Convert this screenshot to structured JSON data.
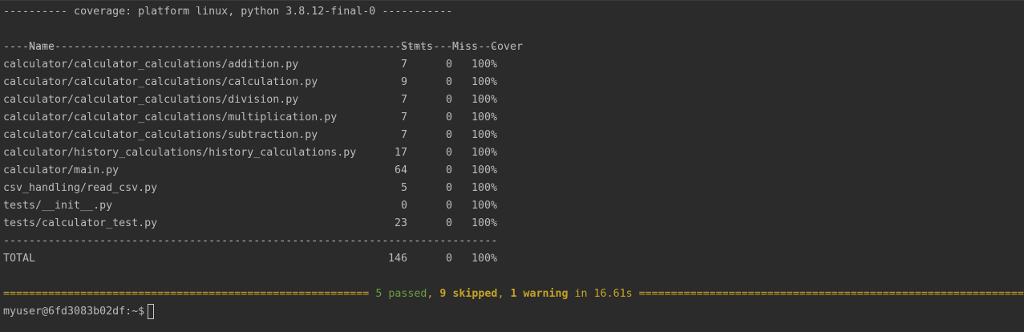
{
  "header_line": "---------- coverage: platform linux, python 3.8.12-final-0 -----------",
  "columns": {
    "name": "Name",
    "stmts": "Stmts",
    "miss": "Miss",
    "cover": "Cover"
  },
  "separator": "-----------------------------------------------------------------------------",
  "rows": [
    {
      "name": "calculator/calculator_calculations/addition.py",
      "stmts": "7",
      "miss": "0",
      "cover": "100%"
    },
    {
      "name": "calculator/calculator_calculations/calculation.py",
      "stmts": "9",
      "miss": "0",
      "cover": "100%"
    },
    {
      "name": "calculator/calculator_calculations/division.py",
      "stmts": "7",
      "miss": "0",
      "cover": "100%"
    },
    {
      "name": "calculator/calculator_calculations/multiplication.py",
      "stmts": "7",
      "miss": "0",
      "cover": "100%"
    },
    {
      "name": "calculator/calculator_calculations/subtraction.py",
      "stmts": "7",
      "miss": "0",
      "cover": "100%"
    },
    {
      "name": "calculator/history_calculations/history_calculations.py",
      "stmts": "17",
      "miss": "0",
      "cover": "100%"
    },
    {
      "name": "calculator/main.py",
      "stmts": "64",
      "miss": "0",
      "cover": "100%"
    },
    {
      "name": "csv_handling/read_csv.py",
      "stmts": "5",
      "miss": "0",
      "cover": "100%"
    },
    {
      "name": "tests/__init__.py",
      "stmts": "0",
      "miss": "0",
      "cover": "100%"
    },
    {
      "name": "tests/calculator_test.py",
      "stmts": "23",
      "miss": "0",
      "cover": "100%"
    }
  ],
  "total": {
    "name": "TOTAL",
    "stmts": "146",
    "miss": "0",
    "cover": "100%"
  },
  "summary": {
    "left_rule": "=========================================================",
    "passed": "5 passed",
    "comma1": ", ",
    "skipped": "9 skipped",
    "comma2": ", ",
    "warning": "1 warning",
    "time": " in 16.61s ",
    "right_rule": "============================================================="
  },
  "prompt": "myuser@6fd3083b02df:~$",
  "colors": {
    "background": "#2b2b2b",
    "text": "#bbbbbb",
    "passed": "#6a9f3e",
    "summary": "#c6a324"
  }
}
